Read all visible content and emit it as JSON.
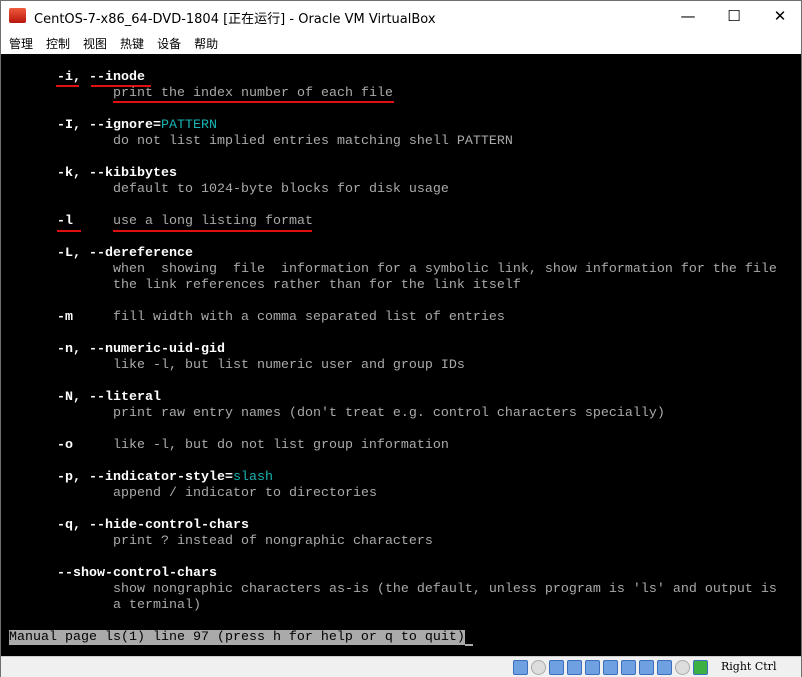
{
  "window": {
    "title": "CentOS-7-x86_64-DVD-1804 [正在运行] - Oracle VM VirtualBox",
    "minimize": "—",
    "maximize": "☐",
    "close": "✕"
  },
  "menu": [
    "管理",
    "控制",
    "视图",
    "热键",
    "设备",
    "帮助"
  ],
  "terminal": {
    "lines": [
      {
        "row": 1,
        "col": 7,
        "parts": [
          {
            "t": "-i, --inode",
            "s": "b"
          }
        ]
      },
      {
        "row": 2,
        "col": 14,
        "parts": [
          {
            "t": "print the index number of each file",
            "s": ""
          }
        ]
      },
      {
        "row": 4,
        "col": 7,
        "parts": [
          {
            "t": "-I, --ignore=",
            "s": "b"
          },
          {
            "t": "PATTERN",
            "s": "cy"
          }
        ]
      },
      {
        "row": 5,
        "col": 14,
        "parts": [
          {
            "t": "do not list implied entries matching shell PATTERN",
            "s": ""
          }
        ]
      },
      {
        "row": 7,
        "col": 7,
        "parts": [
          {
            "t": "-k, --kibibytes",
            "s": "b"
          }
        ]
      },
      {
        "row": 8,
        "col": 14,
        "parts": [
          {
            "t": "default to 1024-byte blocks for disk usage",
            "s": ""
          }
        ]
      },
      {
        "row": 10,
        "col": 7,
        "parts": [
          {
            "t": "-l",
            "s": "b"
          },
          {
            "t": "     use a long listing format",
            "s": ""
          }
        ]
      },
      {
        "row": 12,
        "col": 7,
        "parts": [
          {
            "t": "-L, --dereference",
            "s": "b"
          }
        ]
      },
      {
        "row": 13,
        "col": 14,
        "parts": [
          {
            "t": "when  showing  file  information for a symbolic link, show information for the file",
            "s": ""
          }
        ]
      },
      {
        "row": 14,
        "col": 14,
        "parts": [
          {
            "t": "the link references rather than for the link itself",
            "s": ""
          }
        ]
      },
      {
        "row": 16,
        "col": 7,
        "parts": [
          {
            "t": "-m",
            "s": "b"
          },
          {
            "t": "     fill width with a comma separated list of entries",
            "s": ""
          }
        ]
      },
      {
        "row": 18,
        "col": 7,
        "parts": [
          {
            "t": "-n, --numeric-uid-gid",
            "s": "b"
          }
        ]
      },
      {
        "row": 19,
        "col": 14,
        "parts": [
          {
            "t": "like -l, but list numeric user and group IDs",
            "s": ""
          }
        ]
      },
      {
        "row": 21,
        "col": 7,
        "parts": [
          {
            "t": "-N, --literal",
            "s": "b"
          }
        ]
      },
      {
        "row": 22,
        "col": 14,
        "parts": [
          {
            "t": "print raw entry names (don't treat e.g. control characters specially)",
            "s": ""
          }
        ]
      },
      {
        "row": 24,
        "col": 7,
        "parts": [
          {
            "t": "-o",
            "s": "b"
          },
          {
            "t": "     like -l, but do not list group information",
            "s": ""
          }
        ]
      },
      {
        "row": 26,
        "col": 7,
        "parts": [
          {
            "t": "-p, --indicator-style=",
            "s": "b"
          },
          {
            "t": "slash",
            "s": "cy"
          }
        ]
      },
      {
        "row": 27,
        "col": 14,
        "parts": [
          {
            "t": "append / indicator to directories",
            "s": ""
          }
        ]
      },
      {
        "row": 29,
        "col": 7,
        "parts": [
          {
            "t": "-q, --hide-control-chars",
            "s": "b"
          }
        ]
      },
      {
        "row": 30,
        "col": 14,
        "parts": [
          {
            "t": "print ? instead of nongraphic characters",
            "s": ""
          }
        ]
      },
      {
        "row": 32,
        "col": 7,
        "parts": [
          {
            "t": "--show-control-chars",
            "s": "b"
          }
        ]
      },
      {
        "row": 33,
        "col": 14,
        "parts": [
          {
            "t": "show nongraphic characters as-is (the default, unless program is 'ls' and output is",
            "s": ""
          }
        ]
      },
      {
        "row": 34,
        "col": 14,
        "parts": [
          {
            "t": "a terminal)",
            "s": ""
          }
        ]
      }
    ],
    "status": "Manual page ls(1) line 97 (press h for help or q to quit)",
    "annotation_color": "#e01010"
  },
  "statusbar": {
    "icons": [
      "hard-disk-icon",
      "optical-drive-icon",
      "audio-icon",
      "network-icon",
      "usb-icon",
      "shared-folders-icon",
      "display-icon",
      "video-capture-icon",
      "cpu-icon",
      "mouse-icon",
      "host-key-icon"
    ],
    "host_key": "Right Ctrl"
  }
}
